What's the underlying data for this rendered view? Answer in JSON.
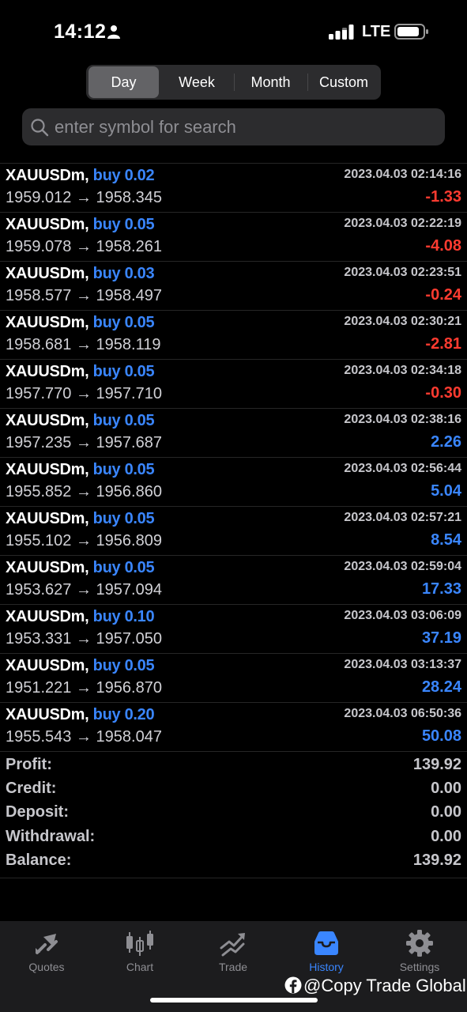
{
  "status_bar": {
    "time": "14:12",
    "network": "LTE"
  },
  "periods": {
    "day": "Day",
    "week": "Week",
    "month": "Month",
    "custom": "Custom",
    "selected": "Day"
  },
  "search": {
    "placeholder": "enter symbol for search"
  },
  "deals": [
    {
      "symbol": "XAUUSDm,",
      "type": "buy 0.02",
      "prices": "1959.012 → 1958.345",
      "time": "2023.04.03 02:14:16",
      "profit": "-1.33"
    },
    {
      "symbol": "XAUUSDm,",
      "type": "buy 0.05",
      "prices": "1959.078 → 1958.261",
      "time": "2023.04.03 02:22:19",
      "profit": "-4.08"
    },
    {
      "symbol": "XAUUSDm,",
      "type": "buy 0.03",
      "prices": "1958.577 → 1958.497",
      "time": "2023.04.03 02:23:51",
      "profit": "-0.24"
    },
    {
      "symbol": "XAUUSDm,",
      "type": "buy 0.05",
      "prices": "1958.681 → 1958.119",
      "time": "2023.04.03 02:30:21",
      "profit": "-2.81"
    },
    {
      "symbol": "XAUUSDm,",
      "type": "buy 0.05",
      "prices": "1957.770 → 1957.710",
      "time": "2023.04.03 02:34:18",
      "profit": "-0.30"
    },
    {
      "symbol": "XAUUSDm,",
      "type": "buy 0.05",
      "prices": "1957.235 → 1957.687",
      "time": "2023.04.03 02:38:16",
      "profit": "2.26"
    },
    {
      "symbol": "XAUUSDm,",
      "type": "buy 0.05",
      "prices": "1955.852 → 1956.860",
      "time": "2023.04.03 02:56:44",
      "profit": "5.04"
    },
    {
      "symbol": "XAUUSDm,",
      "type": "buy 0.05",
      "prices": "1955.102 → 1956.809",
      "time": "2023.04.03 02:57:21",
      "profit": "8.54"
    },
    {
      "symbol": "XAUUSDm,",
      "type": "buy 0.05",
      "prices": "1953.627 → 1957.094",
      "time": "2023.04.03 02:59:04",
      "profit": "17.33"
    },
    {
      "symbol": "XAUUSDm,",
      "type": "buy 0.10",
      "prices": "1953.331 → 1957.050",
      "time": "2023.04.03 03:06:09",
      "profit": "37.19"
    },
    {
      "symbol": "XAUUSDm,",
      "type": "buy 0.05",
      "prices": "1951.221 → 1956.870",
      "time": "2023.04.03 03:13:37",
      "profit": "28.24"
    },
    {
      "symbol": "XAUUSDm,",
      "type": "buy 0.20",
      "prices": "1955.543 → 1958.047",
      "time": "2023.04.03 06:50:36",
      "profit": "50.08"
    }
  ],
  "summary": {
    "profit_label": "Profit:",
    "profit": "139.92",
    "credit_label": "Credit:",
    "credit": "0.00",
    "deposit_label": "Deposit:",
    "deposit": "0.00",
    "withdrawal_label": "Withdrawal:",
    "withdrawal": "0.00",
    "balance_label": "Balance:",
    "balance": "139.92"
  },
  "tabs": {
    "quotes": "Quotes",
    "chart": "Chart",
    "trade": "Trade",
    "history": "History",
    "settings": "Settings",
    "active": "History"
  },
  "watermark": "@Copy Trade Global",
  "colors": {
    "accent": "#3a86ff",
    "loss": "#ff3b30",
    "background": "#000000",
    "tabbar": "#1c1c1e"
  }
}
